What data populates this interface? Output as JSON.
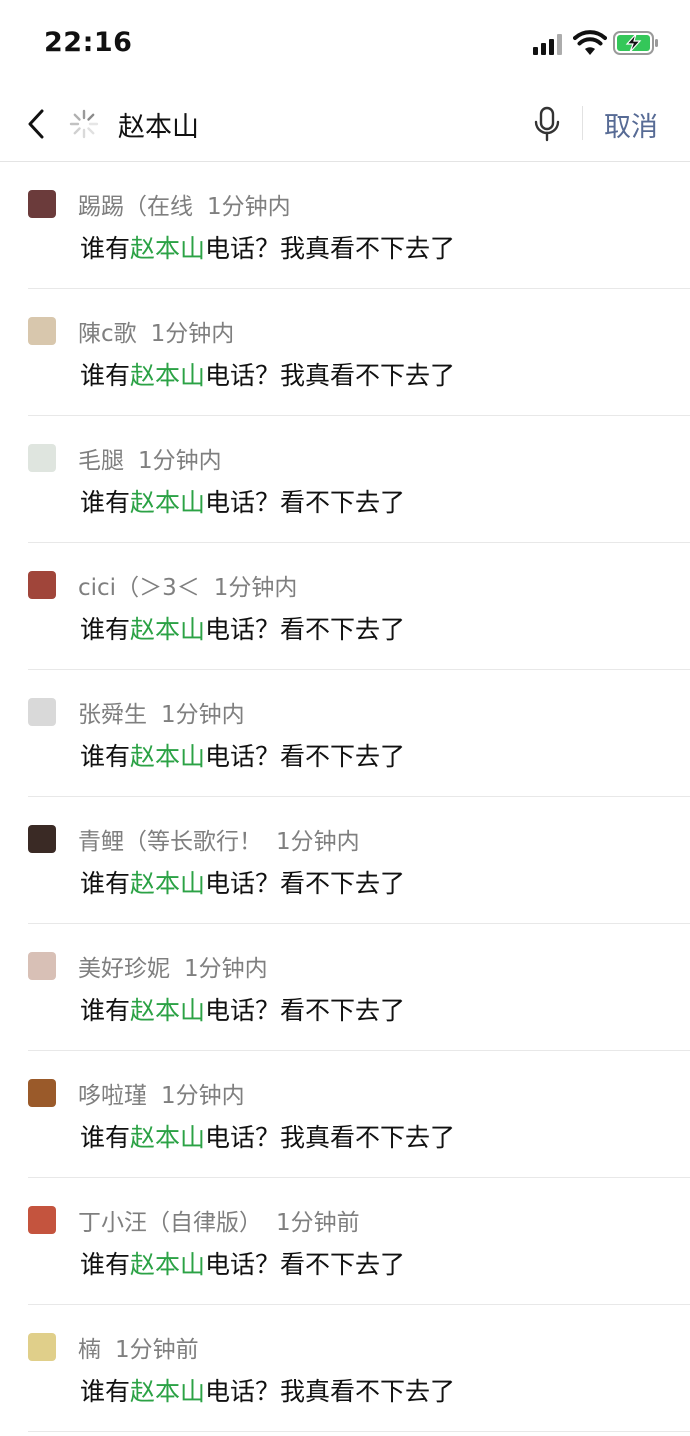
{
  "status_bar": {
    "time": "22:16"
  },
  "search": {
    "query": "赵本山",
    "cancel_label": "取消"
  },
  "colors": {
    "highlight": "#2ba245",
    "cancel": "#576b95",
    "meta_text": "#7f7f7f"
  },
  "results": [
    {
      "name": "踢踢（在线",
      "time": "1分钟内",
      "msg_before": "谁有",
      "msg_highlight": "赵本山",
      "msg_after": "电话？我真看不下去了",
      "avatar_color": "#6b3b3b"
    },
    {
      "name": "陳c歌",
      "time": "1分钟内",
      "msg_before": "谁有",
      "msg_highlight": "赵本山",
      "msg_after": "电话？我真看不下去了",
      "avatar_color": "#d8c7ad"
    },
    {
      "name": "毛腿",
      "time": "1分钟内",
      "msg_before": "谁有",
      "msg_highlight": "赵本山",
      "msg_after": "电话？看不下去了",
      "avatar_color": "#dfe5df"
    },
    {
      "name": "cici（＞3＜",
      "time": "1分钟内",
      "msg_before": "谁有",
      "msg_highlight": "赵本山",
      "msg_after": "电话？看不下去了",
      "avatar_color": "#a0453a"
    },
    {
      "name": "张舜生",
      "time": "1分钟内",
      "msg_before": "谁有",
      "msg_highlight": "赵本山",
      "msg_after": "电话？看不下去了",
      "avatar_color": "#d9d9d9"
    },
    {
      "name": "青鲤（等长歌行！",
      "time": "1分钟内",
      "msg_before": "谁有",
      "msg_highlight": "赵本山",
      "msg_after": "电话？看不下去了",
      "avatar_color": "#3a2a25"
    },
    {
      "name": "美好珍妮",
      "time": "1分钟内",
      "msg_before": "谁有",
      "msg_highlight": "赵本山",
      "msg_after": "电话？看不下去了",
      "avatar_color": "#d8c0b6"
    },
    {
      "name": "哆啦瑾",
      "time": "1分钟内",
      "msg_before": "谁有",
      "msg_highlight": "赵本山",
      "msg_after": "电话？我真看不下去了",
      "avatar_color": "#9a5a2a"
    },
    {
      "name": "丁小汪（自律版）",
      "time": "1分钟前",
      "msg_before": "谁有",
      "msg_highlight": "赵本山",
      "msg_after": "电话？看不下去了",
      "avatar_color": "#c4543e"
    },
    {
      "name": "楠",
      "time": "1分钟前",
      "msg_before": "谁有",
      "msg_highlight": "赵本山",
      "msg_after": "电话？我真看不下去了",
      "avatar_color": "#e0cf8a"
    }
  ]
}
